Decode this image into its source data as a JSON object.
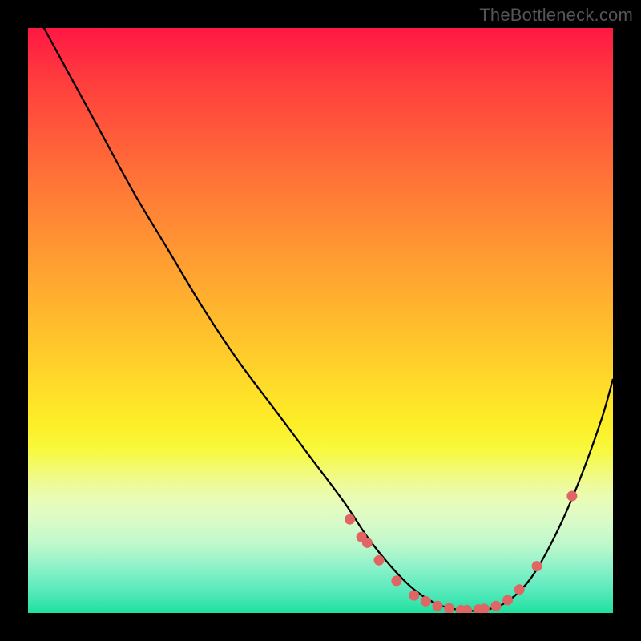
{
  "watermark": "TheBottleneck.com",
  "chart_data": {
    "type": "line",
    "title": "",
    "xlabel": "",
    "ylabel": "",
    "xlim": [
      0,
      100
    ],
    "ylim": [
      0,
      100
    ],
    "series": [
      {
        "name": "curve",
        "x": [
          0,
          6,
          12,
          18,
          24,
          30,
          36,
          42,
          48,
          54,
          58,
          62,
          66,
          70,
          74,
          78,
          82,
          86,
          90,
          94,
          98,
          100
        ],
        "values": [
          105,
          94,
          83,
          72,
          62,
          52,
          43,
          35,
          27,
          19,
          13,
          8,
          4,
          1.5,
          0.5,
          0.5,
          2,
          6,
          13,
          22,
          33,
          40
        ]
      }
    ],
    "points": {
      "name": "marks",
      "x": [
        55,
        57,
        58,
        60,
        63,
        66,
        68,
        70,
        72,
        74,
        75,
        77,
        78,
        80,
        82,
        84,
        87,
        93
      ],
      "values": [
        16,
        13,
        12,
        9,
        5.5,
        3,
        2,
        1.2,
        0.8,
        0.5,
        0.5,
        0.6,
        0.7,
        1.2,
        2.2,
        4,
        8,
        20
      ]
    },
    "gradient_stops": [
      {
        "pos": 0,
        "color": "#ff1744"
      },
      {
        "pos": 50,
        "color": "#ffd22a"
      },
      {
        "pos": 72,
        "color": "#f8f82a"
      },
      {
        "pos": 100,
        "color": "#1ee0a0"
      }
    ]
  }
}
